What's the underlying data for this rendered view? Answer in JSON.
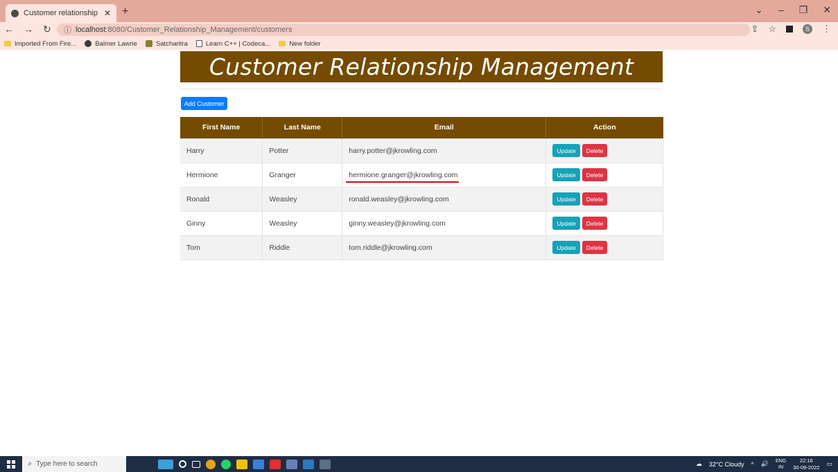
{
  "browser": {
    "tab_title": "Customer relationship managem",
    "new_tab": "+",
    "url_host": "localhost",
    "url_rest": ":8080/Customer_Relationship_Management/customers",
    "profile_initial": "S",
    "bookmarks": [
      "Imported From Fire...",
      "Balmer Lawrie",
      "Satcharitra",
      "Learn C++ | Codeca...",
      "New folder"
    ]
  },
  "page": {
    "title": "Customer Relationship Management",
    "add_button": "Add Customer",
    "columns": [
      "First Name",
      "Last Name",
      "Email",
      "Action"
    ],
    "rows": [
      {
        "first": "Harry",
        "last": "Potter",
        "email": "harry.potter@jkrowling.com"
      },
      {
        "first": "Hermione",
        "last": "Granger",
        "email": "hermione.granger@jkrowling.com"
      },
      {
        "first": "Ronald",
        "last": "Weasley",
        "email": "ronald.weasley@jkrowling.com"
      },
      {
        "first": "Ginny",
        "last": "Weasley",
        "email": "ginny.weasley@jkrowling.com"
      },
      {
        "first": "Tom",
        "last": "Riddle",
        "email": "tom.riddle@jkrowling.com"
      }
    ],
    "update_label": "Update",
    "delete_label": "Delete",
    "colors": {
      "header": "#744b00",
      "add": "#0a7cff",
      "update": "#17a2b8",
      "delete": "#dc3545",
      "highlight": "#c71010"
    }
  },
  "taskbar": {
    "search_placeholder": "Type here to search",
    "weather": "32°C Cloudy",
    "lang_top": "ENG",
    "lang_bottom": "IN",
    "time": "22:16",
    "date": "30-09-2022"
  }
}
